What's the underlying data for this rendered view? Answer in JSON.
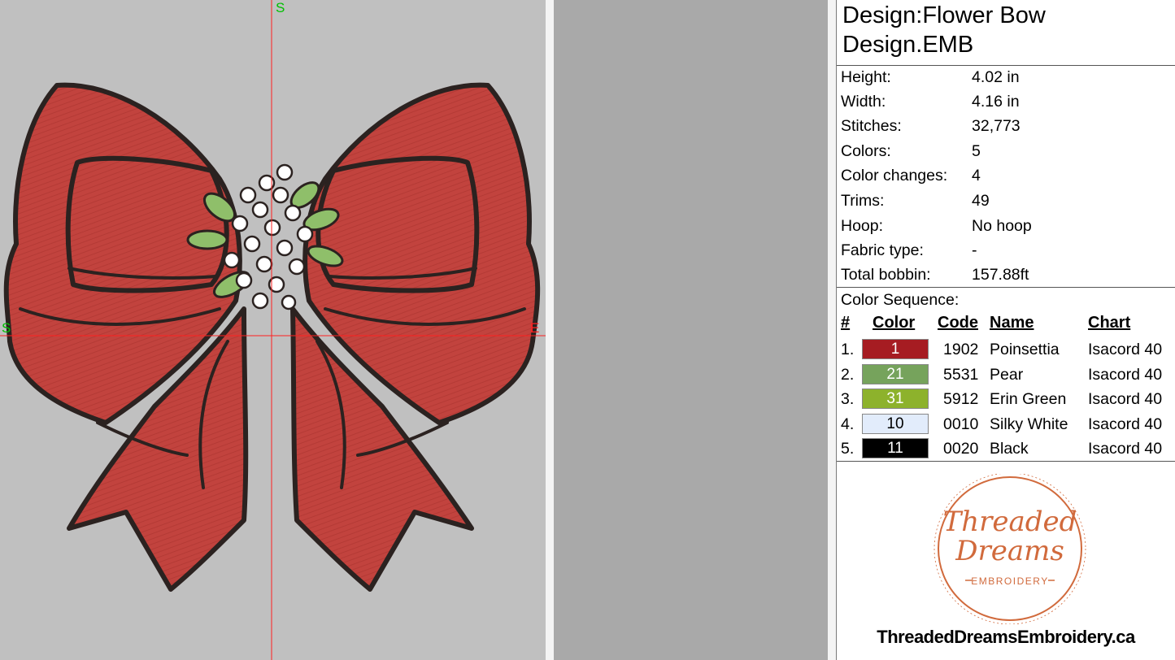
{
  "canvas": {
    "axis_labels": {
      "top": "S",
      "left": "S",
      "right": "E"
    },
    "colors": {
      "background": "#c0c0c0",
      "axis": "#ff2020",
      "label_green": "#00c000",
      "label_red": "#ff2020",
      "bow": "#c2433e",
      "outline": "#2b2220",
      "leaf": "#8fbf6a",
      "flower": "#ffffff"
    }
  },
  "info": {
    "title_line1": "Design:Flower Bow",
    "title_line2": "Design.EMB",
    "stats": [
      {
        "label": "Height:",
        "value": "4.02 in"
      },
      {
        "label": "Width:",
        "value": "4.16 in"
      },
      {
        "label": "Stitches:",
        "value": "32,773"
      },
      {
        "label": "Colors:",
        "value": "5"
      },
      {
        "label": "Color changes:",
        "value": "4"
      },
      {
        "label": "Trims:",
        "value": "49"
      },
      {
        "label": "Hoop:",
        "value": "No hoop"
      },
      {
        "label": "Fabric type:",
        "value": "-"
      },
      {
        "label": "Total bobbin:",
        "value": "157.88ft"
      }
    ],
    "color_sequence_label": "Color Sequence:",
    "columns": {
      "num": "#",
      "color": "Color",
      "code": "Code",
      "name": "Name",
      "chart": "Chart"
    },
    "colors": [
      {
        "num": "1.",
        "swatch": "1",
        "hex": "#a61c22",
        "text_color": "#ffffff",
        "code": "1902",
        "name": "Poinsettia",
        "chart": "Isacord 40"
      },
      {
        "num": "2.",
        "swatch": "21",
        "hex": "#76a35c",
        "text_color": "#ffffff",
        "code": "5531",
        "name": "Pear",
        "chart": "Isacord 40"
      },
      {
        "num": "3.",
        "swatch": "31",
        "hex": "#8db22c",
        "text_color": "#ffffff",
        "code": "5912",
        "name": "Erin Green",
        "chart": "Isacord 40"
      },
      {
        "num": "4.",
        "swatch": "10",
        "hex": "#e2ecfb",
        "text_color": "#000000",
        "code": "0010",
        "name": "Silky White",
        "chart": "Isacord 40"
      },
      {
        "num": "5.",
        "swatch": "11",
        "hex": "#000000",
        "text_color": "#ffffff",
        "code": "0020",
        "name": "Black",
        "chart": "Isacord 40"
      }
    ],
    "logo": {
      "line1": "Threaded",
      "line2": "Dreams",
      "line3": "EMBROIDERY",
      "color": "#d16a3c"
    },
    "website": "ThreadedDreamsEmbroidery.ca"
  }
}
